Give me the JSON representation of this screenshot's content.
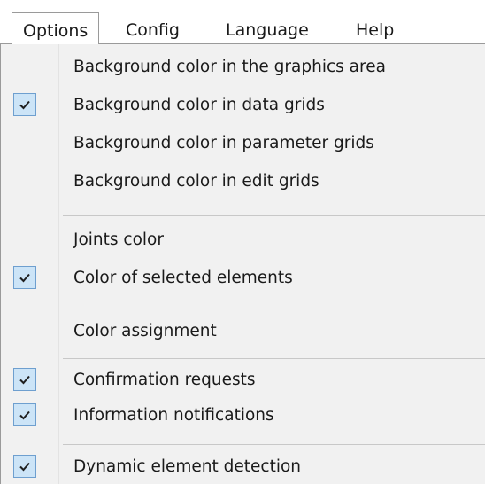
{
  "menubar": {
    "items": [
      "Options",
      "Config",
      "Language",
      "Help"
    ],
    "active": "Options"
  },
  "menu": {
    "items": [
      {
        "label": "Background color in the graphics area",
        "checked": false
      },
      {
        "label": "Background color in data grids",
        "checked": true
      },
      {
        "label": "Background color in parameter grids",
        "checked": false
      },
      {
        "label": "Background color in edit grids",
        "checked": false
      },
      {
        "label": "Joints color",
        "checked": false
      },
      {
        "label": "Color of selected elements",
        "checked": true
      },
      {
        "label": "Color assignment",
        "checked": false
      },
      {
        "label": "Confirmation requests",
        "checked": true
      },
      {
        "label": "Information notifications",
        "checked": true
      },
      {
        "label": "Dynamic element detection",
        "checked": true
      }
    ]
  },
  "icons": {
    "checkmark": "checkmark-icon"
  },
  "colors": {
    "menu_background": "#f1f1f1",
    "check_background": "#cce4f7",
    "check_border": "#6e9fcf",
    "separator": "#c8c8c8"
  }
}
